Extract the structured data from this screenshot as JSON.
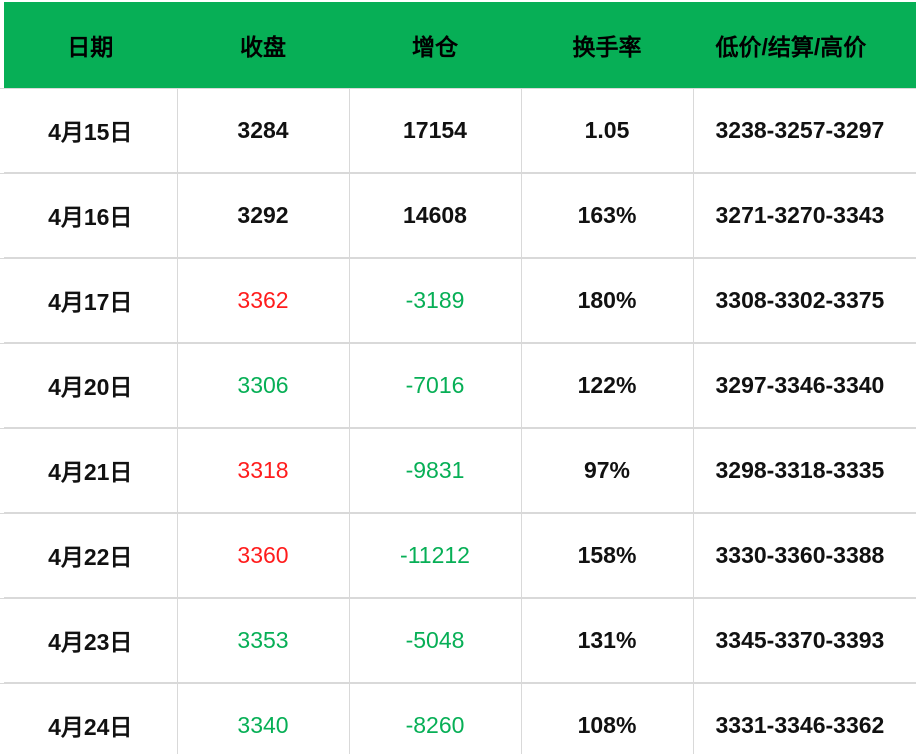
{
  "table": {
    "header_color": "#07af56",
    "up_color": "#ff1c1c",
    "down_color": "#07af56",
    "headers": [
      "日期",
      "收盘",
      "增仓",
      "换手率",
      "低价/结算/高价"
    ],
    "rows": [
      {
        "date": "4月15日",
        "close": "3284",
        "close_color": "default",
        "oi_change": "17154",
        "oi_color": "default",
        "turnover": "1.05",
        "range": "3238-3257-3297"
      },
      {
        "date": "4月16日",
        "close": "3292",
        "close_color": "default",
        "oi_change": "14608",
        "oi_color": "default",
        "turnover": "163%",
        "range": "3271-3270-3343"
      },
      {
        "date": "4月17日",
        "close": "3362",
        "close_color": "red",
        "oi_change": "-3189",
        "oi_color": "green",
        "turnover": "180%",
        "range": "3308-3302-3375"
      },
      {
        "date": "4月20日",
        "close": "3306",
        "close_color": "green",
        "oi_change": "-7016",
        "oi_color": "green",
        "turnover": "122%",
        "range": "3297-3346-3340"
      },
      {
        "date": "4月21日",
        "close": "3318",
        "close_color": "red",
        "oi_change": "-9831",
        "oi_color": "green",
        "turnover": "97%",
        "range": "3298-3318-3335"
      },
      {
        "date": "4月22日",
        "close": "3360",
        "close_color": "red",
        "oi_change": "-11212",
        "oi_color": "green",
        "turnover": "158%",
        "range": "3330-3360-3388"
      },
      {
        "date": "4月23日",
        "close": "3353",
        "close_color": "green",
        "oi_change": "-5048",
        "oi_color": "green",
        "turnover": "131%",
        "range": "3345-3370-3393"
      },
      {
        "date": "4月24日",
        "close": "3340",
        "close_color": "green",
        "oi_change": "-8260",
        "oi_color": "green",
        "turnover": "108%",
        "range": "3331-3346-3362"
      }
    ]
  }
}
